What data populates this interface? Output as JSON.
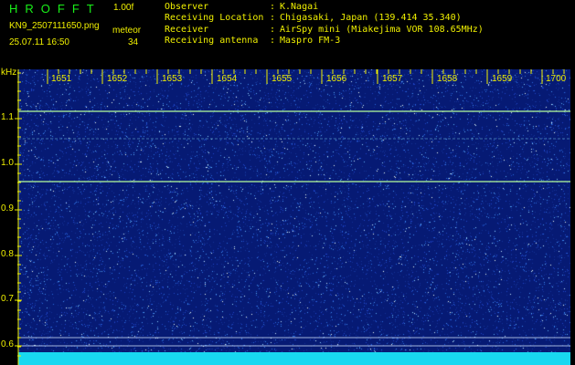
{
  "header": {
    "logo": "HROFFT",
    "version": "1.00f",
    "filename": "KN9_2507111650.png",
    "meteor_label": "meteor",
    "timestamp": "25.07.11 16:50",
    "meteor_count": "34"
  },
  "info": [
    {
      "key": "Observer",
      "sep": ":",
      "value": "K.Nagai"
    },
    {
      "key": "Receiving Location",
      "sep": ":",
      "value": "Chigasaki, Japan (139.414 35.340)"
    },
    {
      "key": "Receiver",
      "sep": ":",
      "value": "AirSpy mini (Miakejima VOR 108.65MHz)"
    },
    {
      "key": "Receiving antenna",
      "sep": ":",
      "value": "Maspro FM-3"
    }
  ],
  "spectrogram": {
    "y_unit": "kHz",
    "y_ticks": [
      "1.1",
      "1.0",
      "0.9",
      "0.8",
      "0.7",
      "0.6"
    ],
    "x_ticks": [
      "1651",
      "1652",
      "1653",
      "1654",
      "1655",
      "1656",
      "1657",
      "1658",
      "1659",
      "1700"
    ],
    "colors": {
      "background": "#061a74",
      "noise_bright": "#7fd8ff",
      "carrier_line": "#b6ff9a",
      "bottom_band": "#18d8f0",
      "label": "#f0f000",
      "logo": "#19f019"
    }
  }
}
